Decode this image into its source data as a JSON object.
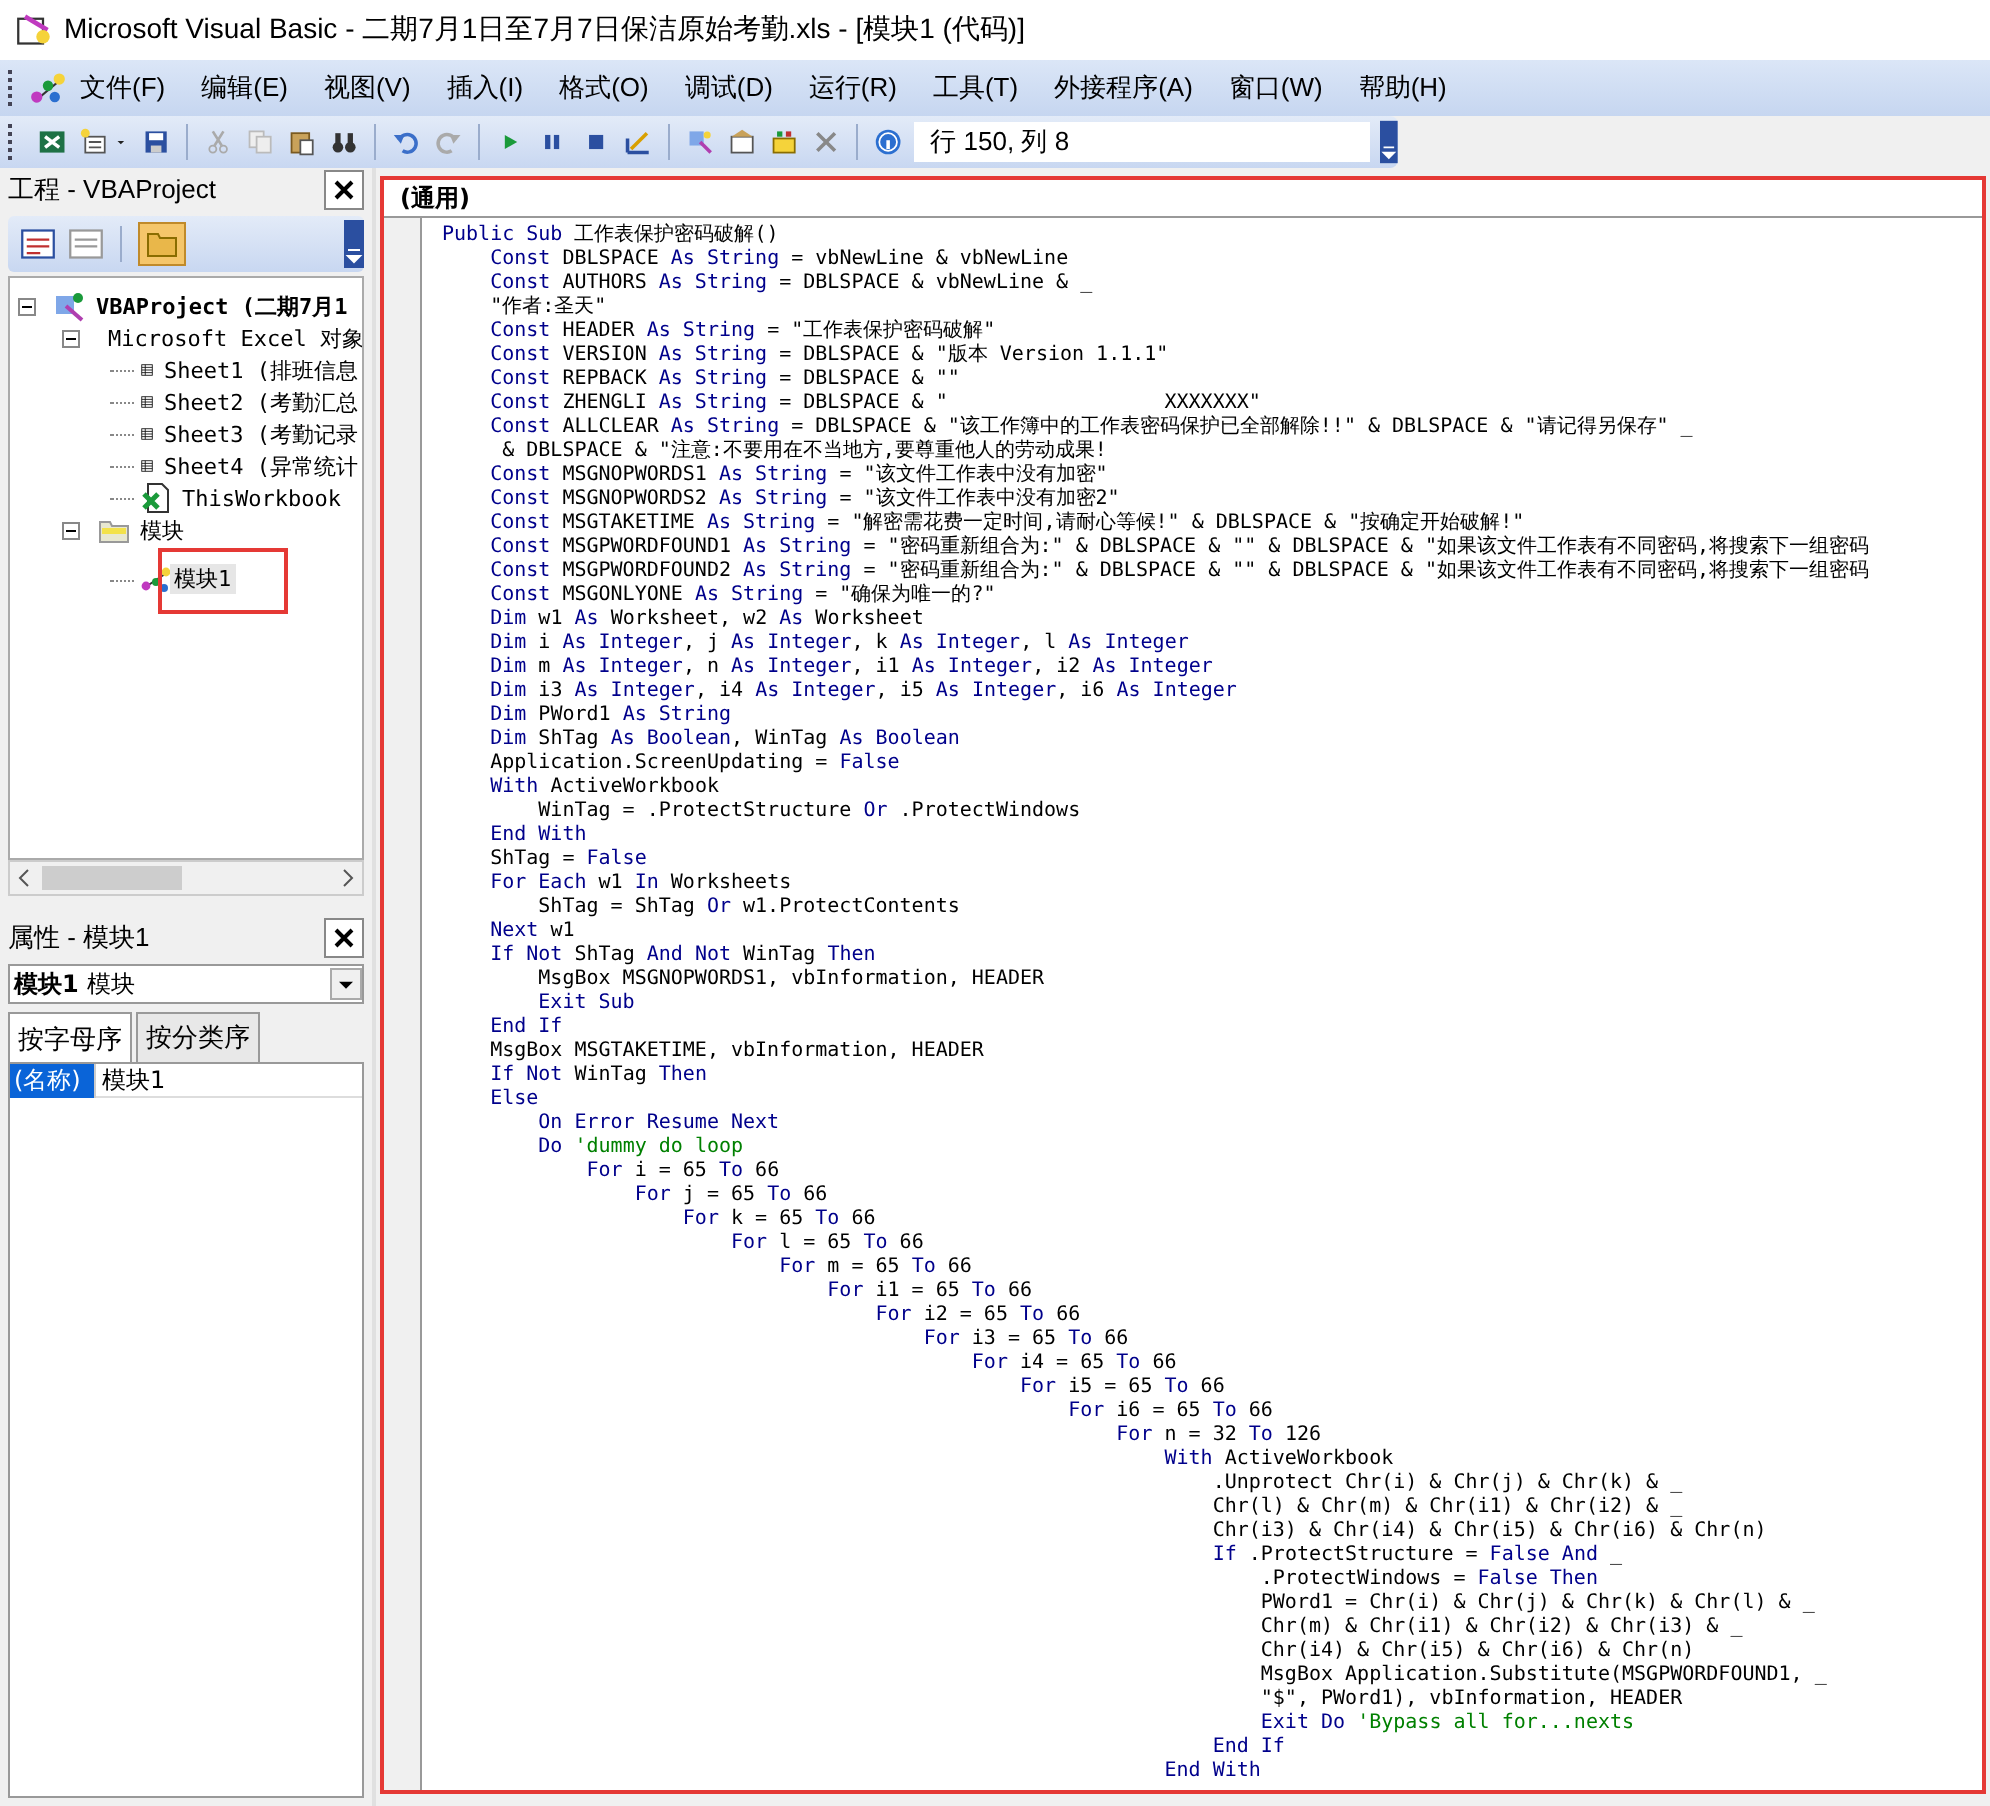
{
  "window": {
    "title": "Microsoft Visual Basic - 二期7月1日至7月7日保洁原始考勤.xls - [模块1 (代码)]"
  },
  "menu": [
    "文件(F)",
    "编辑(E)",
    "视图(V)",
    "插入(I)",
    "格式(O)",
    "调试(D)",
    "运行(R)",
    "工具(T)",
    "外接程序(A)",
    "窗口(W)",
    "帮助(H)"
  ],
  "toolbar": {
    "cursor_position": "行 150, 列 8"
  },
  "project_pane": {
    "title": "工程 - VBAProject",
    "tree": [
      {
        "label": "VBAProject (二期7月1",
        "kind": "project",
        "expanded": true,
        "selected": false,
        "children": [
          {
            "label": "Microsoft Excel 对象",
            "kind": "folder",
            "expanded": true,
            "selected": false,
            "children": [
              {
                "label": "Sheet1 (排班信息",
                "kind": "sheet",
                "selected": false
              },
              {
                "label": "Sheet2 (考勤汇总",
                "kind": "sheet",
                "selected": false
              },
              {
                "label": "Sheet3 (考勤记录",
                "kind": "sheet",
                "selected": false
              },
              {
                "label": "Sheet4 (异常统计",
                "kind": "sheet",
                "selected": false
              },
              {
                "label": "ThisWorkbook",
                "kind": "workbook",
                "selected": false
              }
            ]
          },
          {
            "label": "模块",
            "kind": "folder",
            "expanded": true,
            "selected": false,
            "children": [
              {
                "label": "模块1",
                "kind": "module",
                "selected": true,
                "highlighted": true
              }
            ]
          }
        ]
      }
    ]
  },
  "properties_pane": {
    "title": "属性 - 模块1",
    "object_name": "模块1",
    "object_type": "模块",
    "tabs": [
      {
        "label": "按字母序",
        "selected": true
      },
      {
        "label": "按分类序",
        "selected": false
      }
    ],
    "rows": [
      {
        "name": "(名称)",
        "value": "模块1",
        "selected": true
      }
    ]
  },
  "code_window": {
    "object": "(通用)",
    "highlighted": true,
    "lines": [
      [
        {
          "kind": "keyword",
          "text": "Public Sub"
        },
        {
          "kind": "plain",
          "text": " 工作表保护密码破解()"
        }
      ],
      [
        {
          "kind": "keyword",
          "text": "    Const"
        },
        {
          "kind": "plain",
          "text": " DBLSPACE "
        },
        {
          "kind": "keyword",
          "text": "As String"
        },
        {
          "kind": "plain",
          "text": " = vbNewLine & vbNewLine"
        }
      ],
      [
        {
          "kind": "keyword",
          "text": "    Const"
        },
        {
          "kind": "plain",
          "text": " AUTHORS "
        },
        {
          "kind": "keyword",
          "text": "As String"
        },
        {
          "kind": "plain",
          "text": " = DBLSPACE & vbNewLine & _"
        }
      ],
      [
        {
          "kind": "plain",
          "text": "    \"作者:圣天\""
        }
      ],
      [
        {
          "kind": "keyword",
          "text": "    Const"
        },
        {
          "kind": "plain",
          "text": " HEADER "
        },
        {
          "kind": "keyword",
          "text": "As String"
        },
        {
          "kind": "plain",
          "text": " = \"工作表保护密码破解\""
        }
      ],
      [
        {
          "kind": "keyword",
          "text": "    Const"
        },
        {
          "kind": "plain",
          "text": " VERSION "
        },
        {
          "kind": "keyword",
          "text": "As String"
        },
        {
          "kind": "plain",
          "text": " = DBLSPACE & \"版本 Version 1.1.1\""
        }
      ],
      [
        {
          "kind": "keyword",
          "text": "    Const"
        },
        {
          "kind": "plain",
          "text": " REPBACK "
        },
        {
          "kind": "keyword",
          "text": "As String"
        },
        {
          "kind": "plain",
          "text": " = DBLSPACE & \"\""
        }
      ],
      [
        {
          "kind": "keyword",
          "text": "    Const"
        },
        {
          "kind": "plain",
          "text": " ZHENGLI "
        },
        {
          "kind": "keyword",
          "text": "As String"
        },
        {
          "kind": "plain",
          "text": " = DBLSPACE & \"                  XXXXXXX\""
        }
      ],
      [
        {
          "kind": "keyword",
          "text": "    Const"
        },
        {
          "kind": "plain",
          "text": " ALLCLEAR "
        },
        {
          "kind": "keyword",
          "text": "As String"
        },
        {
          "kind": "plain",
          "text": " = DBLSPACE & \"该工作簿中的工作表密码保护已全部解除!!\" & DBLSPACE & \"请记得另保存\" _"
        }
      ],
      [
        {
          "kind": "plain",
          "text": "     & DBLSPACE & \"注意:不要用在不当地方,要尊重他人的劳动成果!"
        }
      ],
      [
        {
          "kind": "keyword",
          "text": "    Const"
        },
        {
          "kind": "plain",
          "text": " MSGNOPWORDS1 "
        },
        {
          "kind": "keyword",
          "text": "As String"
        },
        {
          "kind": "plain",
          "text": " = \"该文件工作表中没有加密\""
        }
      ],
      [
        {
          "kind": "keyword",
          "text": "    Const"
        },
        {
          "kind": "plain",
          "text": " MSGNOPWORDS2 "
        },
        {
          "kind": "keyword",
          "text": "As String"
        },
        {
          "kind": "plain",
          "text": " = \"该文件工作表中没有加密2\""
        }
      ],
      [
        {
          "kind": "keyword",
          "text": "    Const"
        },
        {
          "kind": "plain",
          "text": " MSGTAKETIME "
        },
        {
          "kind": "keyword",
          "text": "As String"
        },
        {
          "kind": "plain",
          "text": " = \"解密需花费一定时间,请耐心等候!\" & DBLSPACE & \"按确定开始破解!\""
        }
      ],
      [
        {
          "kind": "keyword",
          "text": "    Const"
        },
        {
          "kind": "plain",
          "text": " MSGPWORDFOUND1 "
        },
        {
          "kind": "keyword",
          "text": "As String"
        },
        {
          "kind": "plain",
          "text": " = \"密码重新组合为:\" & DBLSPACE & \"\" & DBLSPACE & \"如果该文件工作表有不同密码,将搜索下一组密码"
        }
      ],
      [
        {
          "kind": "keyword",
          "text": "    Const"
        },
        {
          "kind": "plain",
          "text": " MSGPWORDFOUND2 "
        },
        {
          "kind": "keyword",
          "text": "As String"
        },
        {
          "kind": "plain",
          "text": " = \"密码重新组合为:\" & DBLSPACE & \"\" & DBLSPACE & \"如果该文件工作表有不同密码,将搜索下一组密码"
        }
      ],
      [
        {
          "kind": "keyword",
          "text": "    Const"
        },
        {
          "kind": "plain",
          "text": " MSGONLYONE "
        },
        {
          "kind": "keyword",
          "text": "As String"
        },
        {
          "kind": "plain",
          "text": " = \"确保为唯一的?\""
        }
      ],
      [
        {
          "kind": "keyword",
          "text": "    Dim"
        },
        {
          "kind": "plain",
          "text": " w1 "
        },
        {
          "kind": "keyword",
          "text": "As"
        },
        {
          "kind": "plain",
          "text": " Worksheet, w2 "
        },
        {
          "kind": "keyword",
          "text": "As"
        },
        {
          "kind": "plain",
          "text": " Worksheet"
        }
      ],
      [
        {
          "kind": "keyword",
          "text": "    Dim"
        },
        {
          "kind": "plain",
          "text": " i "
        },
        {
          "kind": "keyword",
          "text": "As Integer"
        },
        {
          "kind": "plain",
          "text": ", j "
        },
        {
          "kind": "keyword",
          "text": "As Integer"
        },
        {
          "kind": "plain",
          "text": ", k "
        },
        {
          "kind": "keyword",
          "text": "As Integer"
        },
        {
          "kind": "plain",
          "text": ", l "
        },
        {
          "kind": "keyword",
          "text": "As Integer"
        }
      ],
      [
        {
          "kind": "keyword",
          "text": "    Dim"
        },
        {
          "kind": "plain",
          "text": " m "
        },
        {
          "kind": "keyword",
          "text": "As Integer"
        },
        {
          "kind": "plain",
          "text": ", n "
        },
        {
          "kind": "keyword",
          "text": "As Integer"
        },
        {
          "kind": "plain",
          "text": ", i1 "
        },
        {
          "kind": "keyword",
          "text": "As Integer"
        },
        {
          "kind": "plain",
          "text": ", i2 "
        },
        {
          "kind": "keyword",
          "text": "As Integer"
        }
      ],
      [
        {
          "kind": "keyword",
          "text": "    Dim"
        },
        {
          "kind": "plain",
          "text": " i3 "
        },
        {
          "kind": "keyword",
          "text": "As Integer"
        },
        {
          "kind": "plain",
          "text": ", i4 "
        },
        {
          "kind": "keyword",
          "text": "As Integer"
        },
        {
          "kind": "plain",
          "text": ", i5 "
        },
        {
          "kind": "keyword",
          "text": "As Integer"
        },
        {
          "kind": "plain",
          "text": ", i6 "
        },
        {
          "kind": "keyword",
          "text": "As Integer"
        }
      ],
      [
        {
          "kind": "keyword",
          "text": "    Dim"
        },
        {
          "kind": "plain",
          "text": " PWord1 "
        },
        {
          "kind": "keyword",
          "text": "As String"
        }
      ],
      [
        {
          "kind": "keyword",
          "text": "    Dim"
        },
        {
          "kind": "plain",
          "text": " ShTag "
        },
        {
          "kind": "keyword",
          "text": "As Boolean"
        },
        {
          "kind": "plain",
          "text": ", WinTag "
        },
        {
          "kind": "keyword",
          "text": "As Boolean"
        }
      ],
      [
        {
          "kind": "plain",
          "text": "    Application.ScreenUpdating = "
        },
        {
          "kind": "keyword",
          "text": "False"
        }
      ],
      [
        {
          "kind": "keyword",
          "text": "    With"
        },
        {
          "kind": "plain",
          "text": " ActiveWorkbook"
        }
      ],
      [
        {
          "kind": "plain",
          "text": "        WinTag = .ProtectStructure "
        },
        {
          "kind": "keyword",
          "text": "Or"
        },
        {
          "kind": "plain",
          "text": " .ProtectWindows"
        }
      ],
      [
        {
          "kind": "keyword",
          "text": "    End With"
        }
      ],
      [
        {
          "kind": "plain",
          "text": "    ShTag = "
        },
        {
          "kind": "keyword",
          "text": "False"
        }
      ],
      [
        {
          "kind": "keyword",
          "text": "    For Each"
        },
        {
          "kind": "plain",
          "text": " w1 "
        },
        {
          "kind": "keyword",
          "text": "In"
        },
        {
          "kind": "plain",
          "text": " Worksheets"
        }
      ],
      [
        {
          "kind": "plain",
          "text": "        ShTag = ShTag "
        },
        {
          "kind": "keyword",
          "text": "Or"
        },
        {
          "kind": "plain",
          "text": " w1.ProtectContents"
        }
      ],
      [
        {
          "kind": "keyword",
          "text": "    Next"
        },
        {
          "kind": "plain",
          "text": " w1"
        }
      ],
      [
        {
          "kind": "keyword",
          "text": "    If Not"
        },
        {
          "kind": "plain",
          "text": " ShTag "
        },
        {
          "kind": "keyword",
          "text": "And Not"
        },
        {
          "kind": "plain",
          "text": " WinTag "
        },
        {
          "kind": "keyword",
          "text": "Then"
        }
      ],
      [
        {
          "kind": "plain",
          "text": "        MsgBox MSGNOPWORDS1, vbInformation, HEADER"
        }
      ],
      [
        {
          "kind": "keyword",
          "text": "        Exit Sub"
        }
      ],
      [
        {
          "kind": "keyword",
          "text": "    End If"
        }
      ],
      [
        {
          "kind": "plain",
          "text": "    MsgBox MSGTAKETIME, vbInformation, HEADER"
        }
      ],
      [
        {
          "kind": "keyword",
          "text": "    If Not"
        },
        {
          "kind": "plain",
          "text": " WinTag "
        },
        {
          "kind": "keyword",
          "text": "Then"
        }
      ],
      [
        {
          "kind": "keyword",
          "text": "    Else"
        }
      ],
      [
        {
          "kind": "keyword",
          "text": "        On Error Resume Next"
        }
      ],
      [
        {
          "kind": "keyword",
          "text": "        Do"
        },
        {
          "kind": "comment",
          "text": " 'dummy do loop"
        }
      ],
      [
        {
          "kind": "keyword",
          "text": "            For"
        },
        {
          "kind": "plain",
          "text": " i = 65 "
        },
        {
          "kind": "keyword",
          "text": "To"
        },
        {
          "kind": "plain",
          "text": " 66"
        }
      ],
      [
        {
          "kind": "keyword",
          "text": "                For"
        },
        {
          "kind": "plain",
          "text": " j = 65 "
        },
        {
          "kind": "keyword",
          "text": "To"
        },
        {
          "kind": "plain",
          "text": " 66"
        }
      ],
      [
        {
          "kind": "keyword",
          "text": "                    For"
        },
        {
          "kind": "plain",
          "text": " k = 65 "
        },
        {
          "kind": "keyword",
          "text": "To"
        },
        {
          "kind": "plain",
          "text": " 66"
        }
      ],
      [
        {
          "kind": "keyword",
          "text": "                        For"
        },
        {
          "kind": "plain",
          "text": " l = 65 "
        },
        {
          "kind": "keyword",
          "text": "To"
        },
        {
          "kind": "plain",
          "text": " 66"
        }
      ],
      [
        {
          "kind": "keyword",
          "text": "                            For"
        },
        {
          "kind": "plain",
          "text": " m = 65 "
        },
        {
          "kind": "keyword",
          "text": "To"
        },
        {
          "kind": "plain",
          "text": " 66"
        }
      ],
      [
        {
          "kind": "keyword",
          "text": "                                For"
        },
        {
          "kind": "plain",
          "text": " i1 = 65 "
        },
        {
          "kind": "keyword",
          "text": "To"
        },
        {
          "kind": "plain",
          "text": " 66"
        }
      ],
      [
        {
          "kind": "keyword",
          "text": "                                    For"
        },
        {
          "kind": "plain",
          "text": " i2 = 65 "
        },
        {
          "kind": "keyword",
          "text": "To"
        },
        {
          "kind": "plain",
          "text": " 66"
        }
      ],
      [
        {
          "kind": "keyword",
          "text": "                                        For"
        },
        {
          "kind": "plain",
          "text": " i3 = 65 "
        },
        {
          "kind": "keyword",
          "text": "To"
        },
        {
          "kind": "plain",
          "text": " 66"
        }
      ],
      [
        {
          "kind": "keyword",
          "text": "                                            For"
        },
        {
          "kind": "plain",
          "text": " i4 = 65 "
        },
        {
          "kind": "keyword",
          "text": "To"
        },
        {
          "kind": "plain",
          "text": " 66"
        }
      ],
      [
        {
          "kind": "keyword",
          "text": "                                                For"
        },
        {
          "kind": "plain",
          "text": " i5 = 65 "
        },
        {
          "kind": "keyword",
          "text": "To"
        },
        {
          "kind": "plain",
          "text": " 66"
        }
      ],
      [
        {
          "kind": "keyword",
          "text": "                                                    For"
        },
        {
          "kind": "plain",
          "text": " i6 = 65 "
        },
        {
          "kind": "keyword",
          "text": "To"
        },
        {
          "kind": "plain",
          "text": " 66"
        }
      ],
      [
        {
          "kind": "keyword",
          "text": "                                                        For"
        },
        {
          "kind": "plain",
          "text": " n = 32 "
        },
        {
          "kind": "keyword",
          "text": "To"
        },
        {
          "kind": "plain",
          "text": " 126"
        }
      ],
      [
        {
          "kind": "keyword",
          "text": "                                                            With"
        },
        {
          "kind": "plain",
          "text": " ActiveWorkbook"
        }
      ],
      [
        {
          "kind": "plain",
          "text": "                                                                .Unprotect Chr(i) & Chr(j) & Chr(k) & _"
        }
      ],
      [
        {
          "kind": "plain",
          "text": "                                                                Chr(l) & Chr(m) & Chr(i1) & Chr(i2) & _"
        }
      ],
      [
        {
          "kind": "plain",
          "text": "                                                                Chr(i3) & Chr(i4) & Chr(i5) & Chr(i6) & Chr(n)"
        }
      ],
      [
        {
          "kind": "keyword",
          "text": "                                                                If"
        },
        {
          "kind": "plain",
          "text": " .ProtectStructure = "
        },
        {
          "kind": "keyword",
          "text": "False And"
        },
        {
          "kind": "plain",
          "text": " _"
        }
      ],
      [
        {
          "kind": "plain",
          "text": "                                                                    .ProtectWindows = "
        },
        {
          "kind": "keyword",
          "text": "False Then"
        }
      ],
      [
        {
          "kind": "plain",
          "text": "                                                                    PWord1 = Chr(i) & Chr(j) & Chr(k) & Chr(l) & _"
        }
      ],
      [
        {
          "kind": "plain",
          "text": "                                                                    Chr(m) & Chr(i1) & Chr(i2) & Chr(i3) & _"
        }
      ],
      [
        {
          "kind": "plain",
          "text": "                                                                    Chr(i4) & Chr(i5) & Chr(i6) & Chr(n)"
        }
      ],
      [
        {
          "kind": "plain",
          "text": "                                                                    MsgBox Application.Substitute(MSGPWORDFOUND1, _"
        }
      ],
      [
        {
          "kind": "plain",
          "text": "                                                                    \"$\", PWord1), vbInformation, HEADER"
        }
      ],
      [
        {
          "kind": "keyword",
          "text": "                                                                    Exit Do"
        },
        {
          "kind": "comment",
          "text": " 'Bypass all for...nexts"
        }
      ],
      [
        {
          "kind": "keyword",
          "text": "                                                                End If"
        }
      ],
      [
        {
          "kind": "keyword",
          "text": "                                                            End With"
        }
      ]
    ]
  }
}
